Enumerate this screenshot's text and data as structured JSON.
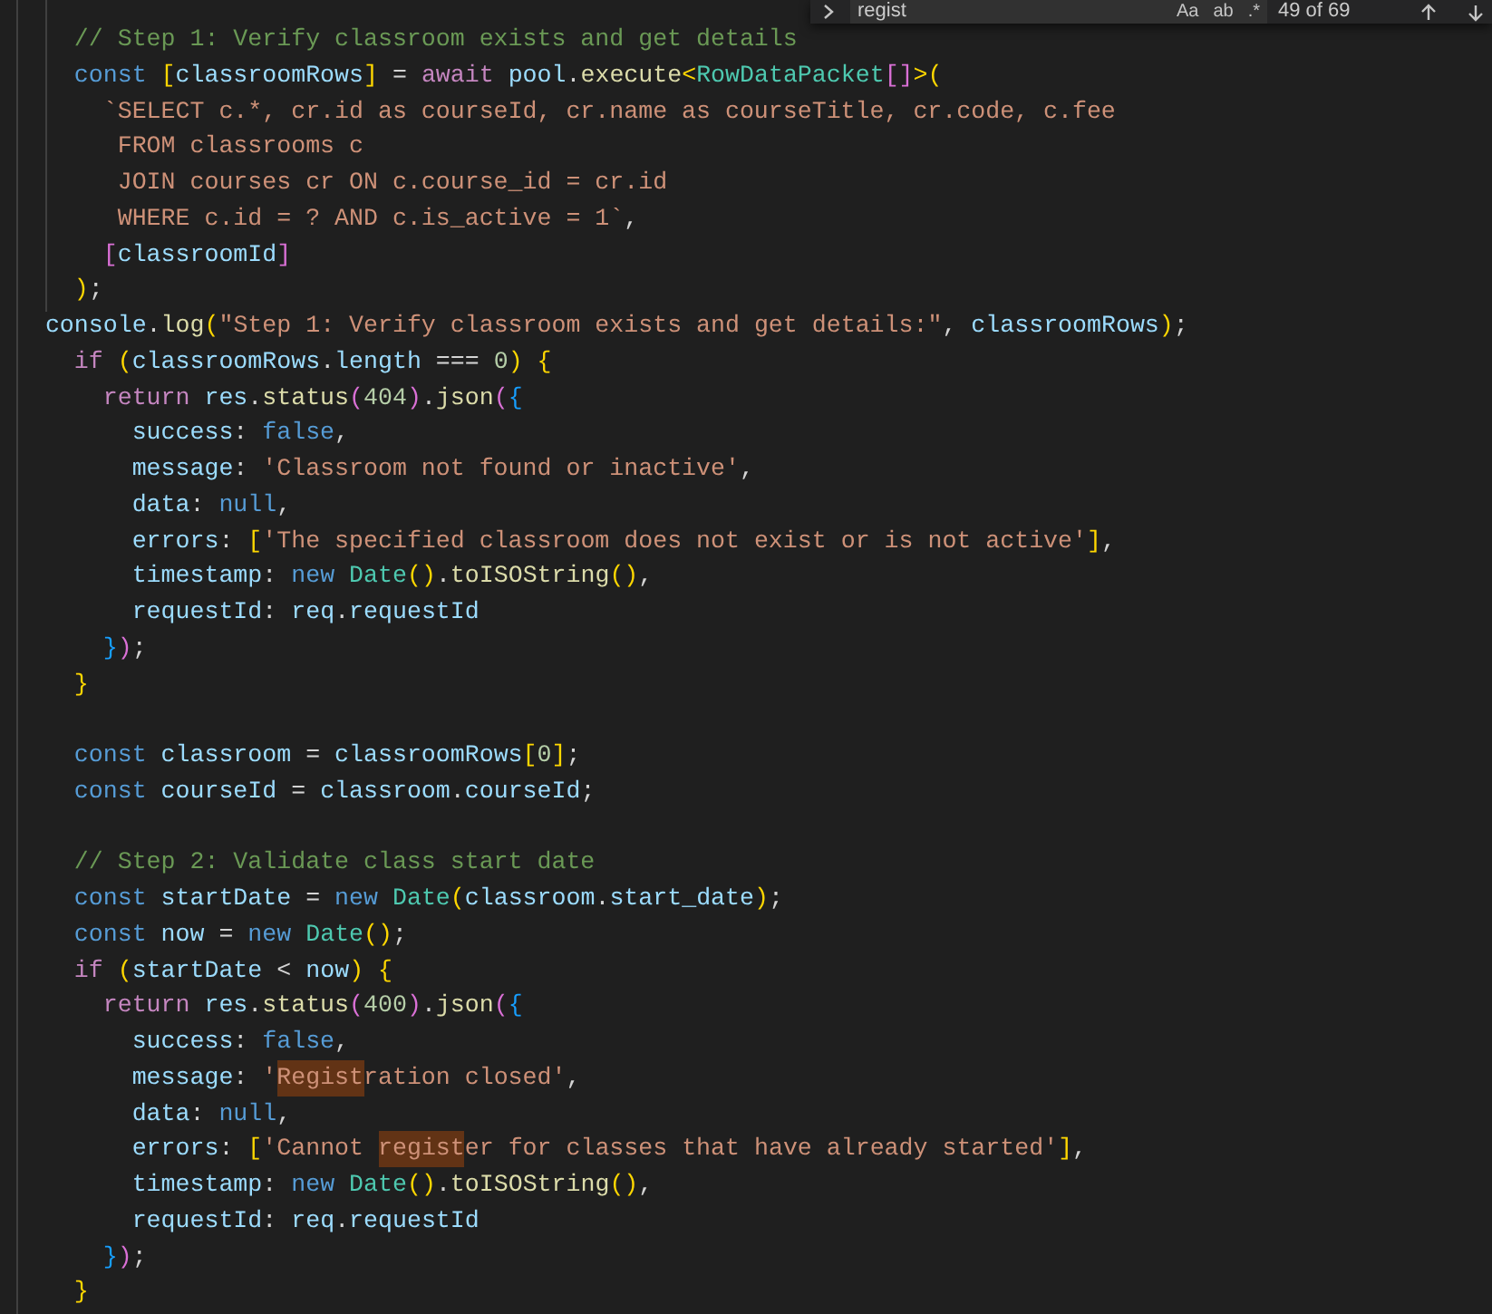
{
  "find_widget": {
    "query": "regist",
    "options": [
      "Aa",
      "ab",
      ".*"
    ],
    "count": "49 of 69"
  },
  "code_lines": [
    {
      "kind": "code",
      "tokens": [
        {
          "text": "     // Step 1: Verify classroom exists and get details",
          "kind": "cm"
        }
      ]
    },
    {
      "kind": "code",
      "tokens": [
        {
          "text": "     const",
          "kind": "kw"
        },
        {
          "text": " [",
          "kind": "b1"
        },
        {
          "text": "classroomRows",
          "kind": "var"
        },
        {
          "text": "]",
          "kind": "b1"
        },
        {
          "text": " = ",
          "kind": "p"
        },
        {
          "text": "await",
          "kind": "ctl"
        },
        {
          "text": " pool",
          "kind": "var"
        },
        {
          "text": ".",
          "kind": "p"
        },
        {
          "text": "execute",
          "kind": "fn"
        },
        {
          "text": "<",
          "kind": "b1"
        },
        {
          "text": "RowDataPacket",
          "kind": "type"
        },
        {
          "text": "[]",
          "kind": "b2"
        },
        {
          "text": ">(",
          "kind": "b1"
        }
      ]
    },
    {
      "kind": "code",
      "tokens": [
        {
          "text": "       `SELECT c.*, cr.id as courseId, cr.name as courseTitle, cr.code, c.fee",
          "kind": "str"
        }
      ]
    },
    {
      "kind": "code",
      "tokens": [
        {
          "text": "        FROM classrooms c",
          "kind": "str"
        }
      ]
    },
    {
      "kind": "code",
      "tokens": [
        {
          "text": "        JOIN courses cr ON c.course_id = cr.id",
          "kind": "str"
        }
      ]
    },
    {
      "kind": "code",
      "tokens": [
        {
          "text": "        WHERE c.id = ? AND c.is_active = 1`",
          "kind": "str"
        },
        {
          "text": ",",
          "kind": "p"
        }
      ]
    },
    {
      "kind": "code",
      "tokens": [
        {
          "text": "       [",
          "kind": "b2"
        },
        {
          "text": "classroomId",
          "kind": "var"
        },
        {
          "text": "]",
          "kind": "b2"
        }
      ]
    },
    {
      "kind": "code",
      "tokens": [
        {
          "text": "     )",
          "kind": "b1"
        },
        {
          "text": ";",
          "kind": "p"
        }
      ]
    },
    {
      "kind": "code",
      "tokens": [
        {
          "text": "   console",
          "kind": "var"
        },
        {
          "text": ".",
          "kind": "p"
        },
        {
          "text": "log",
          "kind": "fn"
        },
        {
          "text": "(",
          "kind": "b1"
        },
        {
          "text": "\"Step 1: Verify classroom exists and get details:\"",
          "kind": "str"
        },
        {
          "text": ", ",
          "kind": "p"
        },
        {
          "text": "classroomRows",
          "kind": "var"
        },
        {
          "text": ")",
          "kind": "b1"
        },
        {
          "text": ";",
          "kind": "p"
        }
      ]
    },
    {
      "kind": "code",
      "tokens": [
        {
          "text": "     if",
          "kind": "ctl"
        },
        {
          "text": " (",
          "kind": "b1"
        },
        {
          "text": "classroomRows",
          "kind": "var"
        },
        {
          "text": ".",
          "kind": "p"
        },
        {
          "text": "length",
          "kind": "var"
        },
        {
          "text": " === ",
          "kind": "p"
        },
        {
          "text": "0",
          "kind": "num"
        },
        {
          "text": ")",
          "kind": "b1"
        },
        {
          "text": " {",
          "kind": "b1"
        }
      ]
    },
    {
      "kind": "code",
      "tokens": [
        {
          "text": "       return",
          "kind": "ctl"
        },
        {
          "text": " res",
          "kind": "var"
        },
        {
          "text": ".",
          "kind": "p"
        },
        {
          "text": "status",
          "kind": "fn"
        },
        {
          "text": "(",
          "kind": "b2"
        },
        {
          "text": "404",
          "kind": "num"
        },
        {
          "text": ")",
          "kind": "b2"
        },
        {
          "text": ".",
          "kind": "p"
        },
        {
          "text": "json",
          "kind": "fn"
        },
        {
          "text": "(",
          "kind": "b2"
        },
        {
          "text": "{",
          "kind": "b3"
        }
      ]
    },
    {
      "kind": "code",
      "tokens": [
        {
          "text": "         success",
          "kind": "var"
        },
        {
          "text": ": ",
          "kind": "p"
        },
        {
          "text": "false",
          "kind": "kw"
        },
        {
          "text": ",",
          "kind": "p"
        }
      ]
    },
    {
      "kind": "code",
      "tokens": [
        {
          "text": "         message",
          "kind": "var"
        },
        {
          "text": ": ",
          "kind": "p"
        },
        {
          "text": "'Classroom not found or inactive'",
          "kind": "str"
        },
        {
          "text": ",",
          "kind": "p"
        }
      ]
    },
    {
      "kind": "code",
      "tokens": [
        {
          "text": "         data",
          "kind": "var"
        },
        {
          "text": ": ",
          "kind": "p"
        },
        {
          "text": "null",
          "kind": "kw"
        },
        {
          "text": ",",
          "kind": "p"
        }
      ]
    },
    {
      "kind": "code",
      "tokens": [
        {
          "text": "         errors",
          "kind": "var"
        },
        {
          "text": ": ",
          "kind": "p"
        },
        {
          "text": "[",
          "kind": "b1"
        },
        {
          "text": "'The specified classroom does not exist or is not active'",
          "kind": "str"
        },
        {
          "text": "]",
          "kind": "b1"
        },
        {
          "text": ",",
          "kind": "p"
        }
      ]
    },
    {
      "kind": "code",
      "tokens": [
        {
          "text": "         timestamp",
          "kind": "var"
        },
        {
          "text": ": ",
          "kind": "p"
        },
        {
          "text": "new",
          "kind": "kw"
        },
        {
          "text": " Date",
          "kind": "type"
        },
        {
          "text": "()",
          "kind": "b1"
        },
        {
          "text": ".",
          "kind": "p"
        },
        {
          "text": "toISOString",
          "kind": "fn"
        },
        {
          "text": "()",
          "kind": "b1"
        },
        {
          "text": ",",
          "kind": "p"
        }
      ]
    },
    {
      "kind": "code",
      "tokens": [
        {
          "text": "         requestId",
          "kind": "var"
        },
        {
          "text": ": ",
          "kind": "p"
        },
        {
          "text": "req",
          "kind": "var"
        },
        {
          "text": ".",
          "kind": "p"
        },
        {
          "text": "requestId",
          "kind": "var"
        }
      ]
    },
    {
      "kind": "code",
      "tokens": [
        {
          "text": "       }",
          "kind": "b3"
        },
        {
          "text": ")",
          "kind": "b2"
        },
        {
          "text": ";",
          "kind": "p"
        }
      ]
    },
    {
      "kind": "code",
      "tokens": [
        {
          "text": "     }",
          "kind": "b1"
        }
      ]
    },
    {
      "kind": "blank"
    },
    {
      "kind": "code",
      "tokens": [
        {
          "text": "     const",
          "kind": "kw"
        },
        {
          "text": " classroom",
          "kind": "var"
        },
        {
          "text": " = ",
          "kind": "p"
        },
        {
          "text": "classroomRows",
          "kind": "var"
        },
        {
          "text": "[",
          "kind": "b1"
        },
        {
          "text": "0",
          "kind": "num"
        },
        {
          "text": "]",
          "kind": "b1"
        },
        {
          "text": ";",
          "kind": "p"
        }
      ]
    },
    {
      "kind": "code",
      "tokens": [
        {
          "text": "     const",
          "kind": "kw"
        },
        {
          "text": " courseId",
          "kind": "var"
        },
        {
          "text": " = ",
          "kind": "p"
        },
        {
          "text": "classroom",
          "kind": "var"
        },
        {
          "text": ".",
          "kind": "p"
        },
        {
          "text": "courseId",
          "kind": "var"
        },
        {
          "text": ";",
          "kind": "p"
        }
      ]
    },
    {
      "kind": "blank"
    },
    {
      "kind": "code",
      "tokens": [
        {
          "text": "     // Step 2: Validate class start date",
          "kind": "cm"
        }
      ]
    },
    {
      "kind": "code",
      "tokens": [
        {
          "text": "     const",
          "kind": "kw"
        },
        {
          "text": " startDate",
          "kind": "var"
        },
        {
          "text": " = ",
          "kind": "p"
        },
        {
          "text": "new",
          "kind": "kw"
        },
        {
          "text": " Date",
          "kind": "type"
        },
        {
          "text": "(",
          "kind": "b1"
        },
        {
          "text": "classroom",
          "kind": "var"
        },
        {
          "text": ".",
          "kind": "p"
        },
        {
          "text": "start_date",
          "kind": "var"
        },
        {
          "text": ")",
          "kind": "b1"
        },
        {
          "text": ";",
          "kind": "p"
        }
      ]
    },
    {
      "kind": "code",
      "tokens": [
        {
          "text": "     const",
          "kind": "kw"
        },
        {
          "text": " now",
          "kind": "var"
        },
        {
          "text": " = ",
          "kind": "p"
        },
        {
          "text": "new",
          "kind": "kw"
        },
        {
          "text": " Date",
          "kind": "type"
        },
        {
          "text": "()",
          "kind": "b1"
        },
        {
          "text": ";",
          "kind": "p"
        }
      ]
    },
    {
      "kind": "code",
      "tokens": [
        {
          "text": "     if",
          "kind": "ctl"
        },
        {
          "text": " (",
          "kind": "b1"
        },
        {
          "text": "startDate",
          "kind": "var"
        },
        {
          "text": " < ",
          "kind": "p"
        },
        {
          "text": "now",
          "kind": "var"
        },
        {
          "text": ")",
          "kind": "b1"
        },
        {
          "text": " {",
          "kind": "b1"
        }
      ]
    },
    {
      "kind": "code",
      "tokens": [
        {
          "text": "       return",
          "kind": "ctl"
        },
        {
          "text": " res",
          "kind": "var"
        },
        {
          "text": ".",
          "kind": "p"
        },
        {
          "text": "status",
          "kind": "fn"
        },
        {
          "text": "(",
          "kind": "b2"
        },
        {
          "text": "400",
          "kind": "num"
        },
        {
          "text": ")",
          "kind": "b2"
        },
        {
          "text": ".",
          "kind": "p"
        },
        {
          "text": "json",
          "kind": "fn"
        },
        {
          "text": "(",
          "kind": "b2"
        },
        {
          "text": "{",
          "kind": "b3"
        }
      ]
    },
    {
      "kind": "code",
      "tokens": [
        {
          "text": "         success",
          "kind": "var"
        },
        {
          "text": ": ",
          "kind": "p"
        },
        {
          "text": "false",
          "kind": "kw"
        },
        {
          "text": ",",
          "kind": "p"
        }
      ]
    },
    {
      "kind": "code",
      "tokens": [
        {
          "text": "         message",
          "kind": "var"
        },
        {
          "text": ": ",
          "kind": "p"
        },
        {
          "text": "'",
          "kind": "str"
        },
        {
          "text": "Regist",
          "kind": "match"
        },
        {
          "text": "ration closed'",
          "kind": "str"
        },
        {
          "text": ",",
          "kind": "p"
        }
      ]
    },
    {
      "kind": "code",
      "tokens": [
        {
          "text": "         data",
          "kind": "var"
        },
        {
          "text": ": ",
          "kind": "p"
        },
        {
          "text": "null",
          "kind": "kw"
        },
        {
          "text": ",",
          "kind": "p"
        }
      ]
    },
    {
      "kind": "code",
      "tokens": [
        {
          "text": "         errors",
          "kind": "var"
        },
        {
          "text": ": ",
          "kind": "p"
        },
        {
          "text": "[",
          "kind": "b1"
        },
        {
          "text": "'Cannot ",
          "kind": "str"
        },
        {
          "text": "regist",
          "kind": "match"
        },
        {
          "text": "er for classes that have already started'",
          "kind": "str"
        },
        {
          "text": "]",
          "kind": "b1"
        },
        {
          "text": ",",
          "kind": "p"
        }
      ]
    },
    {
      "kind": "code",
      "tokens": [
        {
          "text": "         timestamp",
          "kind": "var"
        },
        {
          "text": ": ",
          "kind": "p"
        },
        {
          "text": "new",
          "kind": "kw"
        },
        {
          "text": " Date",
          "kind": "type"
        },
        {
          "text": "()",
          "kind": "b1"
        },
        {
          "text": ".",
          "kind": "p"
        },
        {
          "text": "toISOString",
          "kind": "fn"
        },
        {
          "text": "()",
          "kind": "b1"
        },
        {
          "text": ",",
          "kind": "p"
        }
      ]
    },
    {
      "kind": "code",
      "tokens": [
        {
          "text": "         requestId",
          "kind": "var"
        },
        {
          "text": ": ",
          "kind": "p"
        },
        {
          "text": "req",
          "kind": "var"
        },
        {
          "text": ".",
          "kind": "p"
        },
        {
          "text": "requestId",
          "kind": "var"
        }
      ]
    },
    {
      "kind": "code",
      "tokens": [
        {
          "text": "       }",
          "kind": "b3"
        },
        {
          "text": ")",
          "kind": "b2"
        },
        {
          "text": ";",
          "kind": "p"
        }
      ]
    },
    {
      "kind": "code",
      "tokens": [
        {
          "text": "     }",
          "kind": "b1"
        }
      ]
    }
  ]
}
